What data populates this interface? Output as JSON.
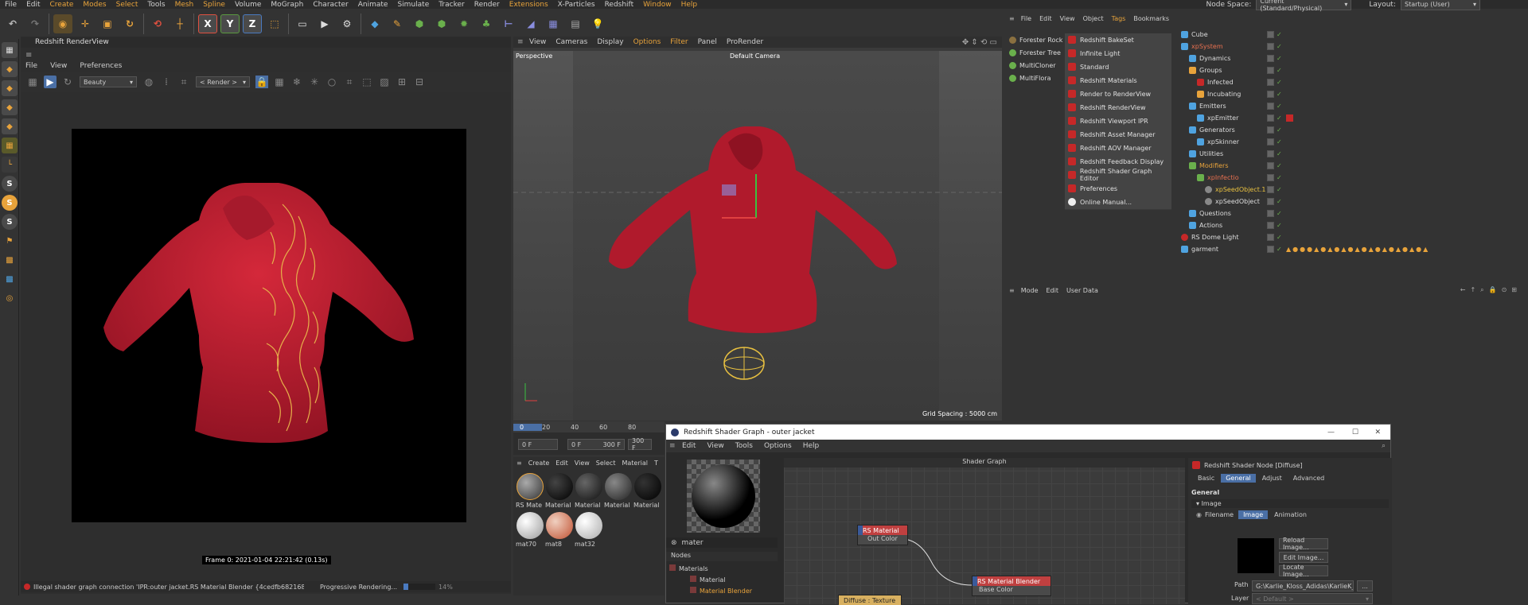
{
  "menubar": {
    "items": [
      "File",
      "Edit",
      "Create",
      "Modes",
      "Select",
      "Tools",
      "Mesh",
      "Spline",
      "Volume",
      "MoGraph",
      "Character",
      "Animate",
      "Simulate",
      "Tracker",
      "Render",
      "Extensions",
      "X-Particles",
      "Redshift",
      "Window",
      "Help"
    ],
    "node_space_label": "Node Space:",
    "node_space_value": "Current (Standard/Physical)",
    "layout_label": "Layout:",
    "layout_value": "Startup (User)"
  },
  "toolbar": {
    "axis_x": "X",
    "axis_y": "Y",
    "axis_z": "Z"
  },
  "left_tools": [
    "S",
    "S",
    "S"
  ],
  "render_view": {
    "title": "Redshift RenderView",
    "menu": [
      "File",
      "View",
      "Preferences"
    ],
    "aov_value": "Beauty",
    "render_dropdown": "< Render >",
    "frame_info": "Frame 0: 2021-01-04 22:21:42 (0.13s)",
    "status_error": "Illegal shader graph connection 'IPR:outer jacket.RS Material Blender {4cedfb6821681501615c900782a10000}' t ...",
    "status_progress": "Progressive Rendering...",
    "status_percent": "14%",
    "progress": 0.14
  },
  "viewport": {
    "menu": [
      "View",
      "Cameras",
      "Display",
      "Options",
      "Filter",
      "Panel",
      "ProRender"
    ],
    "name": "Perspective",
    "camera": "Default Camera",
    "grid_spacing": "Grid Spacing : 5000 cm"
  },
  "timeline": {
    "ticks": [
      "0",
      "20",
      "40",
      "60",
      "80"
    ],
    "start": "0 F",
    "cur": "0 F",
    "end": "300 F",
    "end2": "300 F"
  },
  "material_manager": {
    "menu": [
      "Create",
      "Edit",
      "View",
      "Select",
      "Material",
      "T"
    ],
    "materials": [
      "RS Mate",
      "Material",
      "Material",
      "Material",
      "Material",
      "mat70",
      "mat8",
      "mat32"
    ]
  },
  "objects_list": [
    "Forester Rock",
    "Forester Tree",
    "MultiCloner",
    "MultiFlora"
  ],
  "redshift_menu": [
    "Redshift BakeSet",
    "Infinite Light",
    "Standard",
    "Redshift Materials",
    "Render to RenderView",
    "Redshift RenderView",
    "Redshift Viewport IPR",
    "Redshift Asset Manager",
    "Redshift AOV Manager",
    "Redshift Feedback Display",
    "Redshift Shader Graph Editor",
    "Preferences",
    "Online Manual..."
  ],
  "object_manager": {
    "menu": [
      "File",
      "Edit",
      "View",
      "Object",
      "Tags",
      "Bookmarks"
    ],
    "tree": [
      "Cube",
      "xpSystem",
      "Dynamics",
      "Groups",
      "Infected",
      "Incubating",
      "Emitters",
      "xpEmitter",
      "Generators",
      "xpSkinner",
      "Utilities",
      "Modifiers",
      "xpInfectio",
      "xpSeedObject.1",
      "xpSeedObject",
      "Questions",
      "Actions",
      "RS Dome Light",
      "garment"
    ]
  },
  "attributes": {
    "menu": [
      "Mode",
      "Edit",
      "User Data"
    ]
  },
  "shader_graph": {
    "title": "Redshift Shader Graph - outer jacket",
    "menu": [
      "Edit",
      "View",
      "Tools",
      "Options",
      "Help"
    ],
    "search_value": "mater",
    "nodes_header": "Nodes",
    "tree": [
      "Materials",
      "Material",
      "Material Blender"
    ],
    "graph_title": "Shader Graph",
    "node_rs_material": "RS Material",
    "node_rs_material_port": "Out Color",
    "node_blender": "RS Material Blender",
    "node_blender_port": "Base Color",
    "node_diffuse": "Diffuse : Texture",
    "right_title": "Redshift Shader Node [Diffuse]",
    "right_tabs": [
      "Basic",
      "General",
      "Adjust",
      "Advanced"
    ],
    "section_general": "General",
    "section_image": "Image",
    "filename_label": "Filename",
    "image_tabs": [
      "Image",
      "Animation"
    ],
    "reload_btn": "Reload Image...",
    "edit_btn": "Edit Image...",
    "locate_btn": "Locate Image...",
    "path_label": "Path",
    "path_value": "G:\\Karlie_Kloss_Adidas\\KarlieK_Ac",
    "path_btn": "...",
    "layer_label": "Layer",
    "layer_value": "< Default >"
  }
}
